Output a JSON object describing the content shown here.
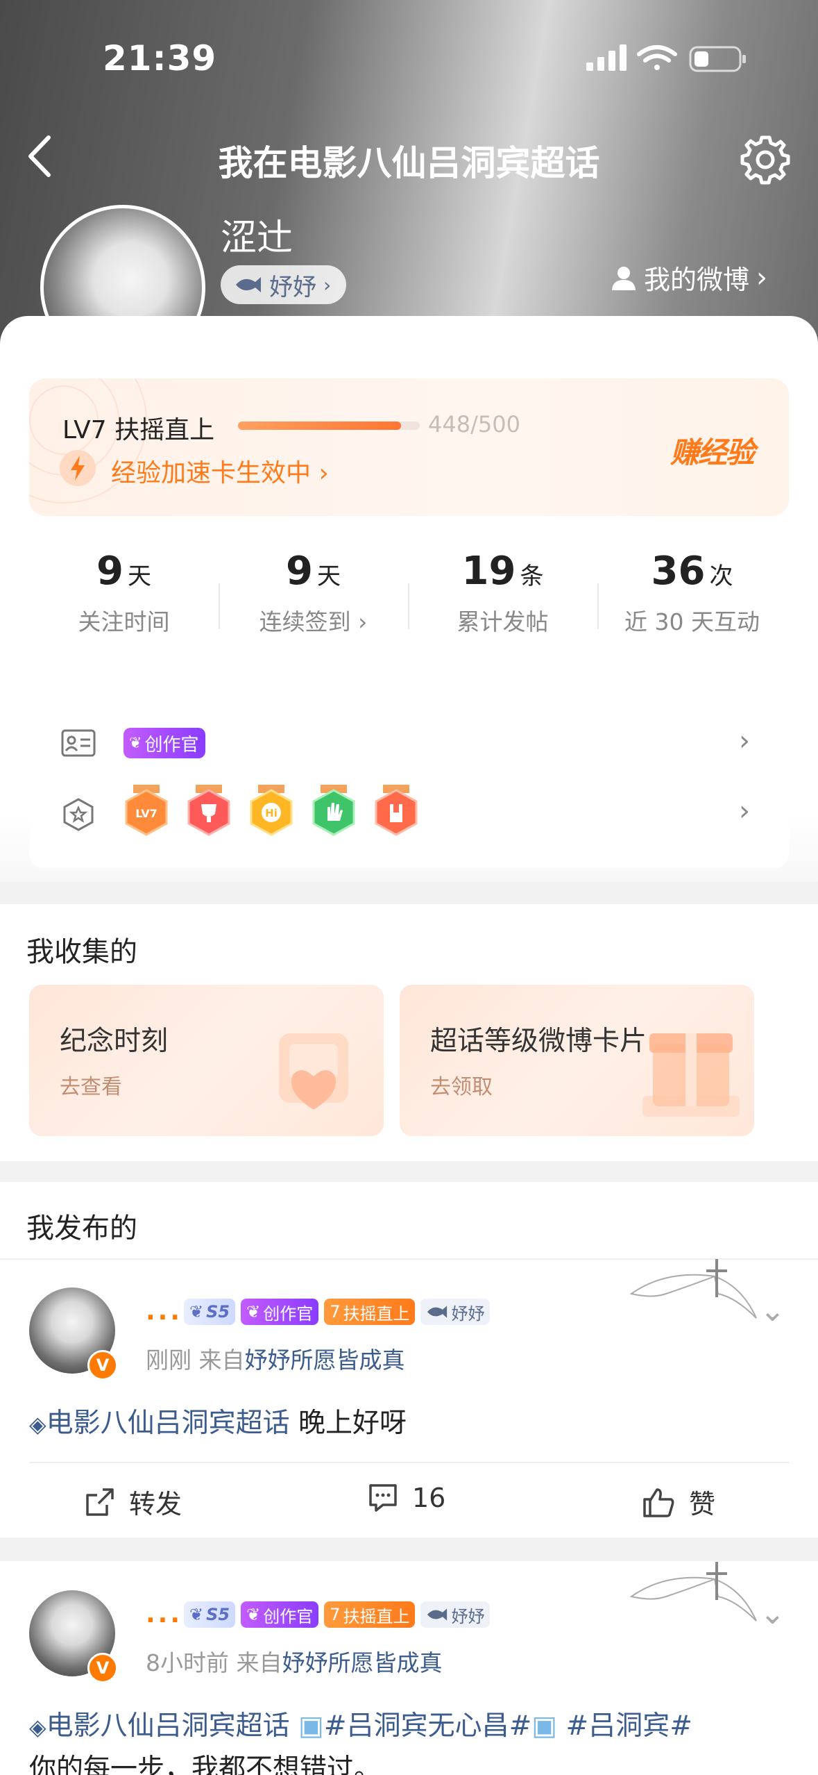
{
  "status": {
    "time": "21:39"
  },
  "nav": {
    "title": "我在电影八仙吕洞宾超话"
  },
  "profile": {
    "name": "涩辻",
    "fan_tag": "妤妤",
    "my_weibo": "我的微博"
  },
  "level": {
    "label": "LV7 扶摇直上",
    "progress": 0.896,
    "score": "448/500",
    "boost": "经验加速卡生效中",
    "earn": "赚经验"
  },
  "stats": [
    {
      "num": "9",
      "unit": "天",
      "label": "关注时间"
    },
    {
      "num": "9",
      "unit": "天",
      "label": "连续签到"
    },
    {
      "num": "19",
      "unit": "条",
      "label": "累计发帖"
    },
    {
      "num": "36",
      "unit": "次",
      "label": "近 30 天互动"
    }
  ],
  "badges": {
    "creator": "创作官",
    "medals": [
      "LV7",
      "trophy",
      "Hi",
      "hand",
      "rock"
    ]
  },
  "collection": {
    "title": "我收集的",
    "cards": [
      {
        "name": "纪念时刻",
        "sub": "去查看"
      },
      {
        "name": "超话等级微博卡片",
        "sub": "去领取"
      }
    ]
  },
  "posts_section": {
    "title": "我发布的"
  },
  "posts": [
    {
      "name": "...",
      "chips": {
        "s5": "S5",
        "creator": "创作官",
        "level": "扶摇直上",
        "level_num": "7",
        "fan": "妤妤"
      },
      "time": "刚刚",
      "source_prefix": "来自",
      "source": "妤妤所愿皆成真",
      "topic": "电影八仙吕洞宾超话",
      "text": "晚上好呀",
      "repost": "转发",
      "comments": "16",
      "like": "赞"
    },
    {
      "name": "...",
      "chips": {
        "s5": "S5",
        "creator": "创作官",
        "level": "扶摇直上",
        "level_num": "7",
        "fan": "妤妤"
      },
      "time": "8小时前",
      "source_prefix": "来自",
      "source": "妤妤所愿皆成真",
      "topic": "电影八仙吕洞宾超话",
      "hashtag1": "#吕洞宾无心昌#",
      "hashtag2": "#吕洞宾#",
      "text": "你的每一步，我都不想错过。"
    }
  ],
  "colors": {
    "accent": "#ff7a1a",
    "link": "#3c5c8e",
    "purple": "#8a3cff"
  }
}
